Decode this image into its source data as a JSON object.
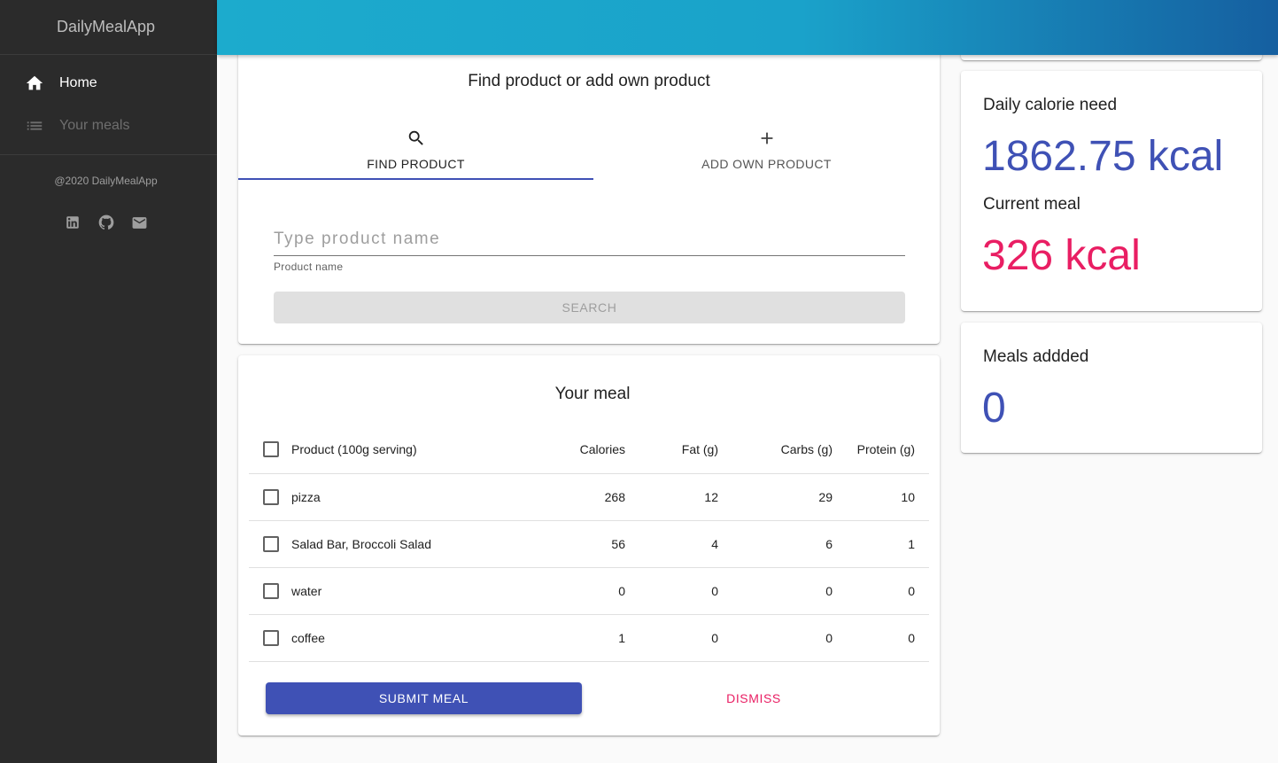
{
  "app": {
    "title": "DailyMealApp"
  },
  "sidebar": {
    "items": [
      {
        "label": "Home",
        "icon": "home-icon",
        "active": true
      },
      {
        "label": "Your meals",
        "icon": "list-icon",
        "active": false
      }
    ],
    "copyright": "@2020 DailyMealApp",
    "socials": [
      "linkedin-icon",
      "github-icon",
      "mail-icon"
    ]
  },
  "find_product": {
    "title": "Find product or add own product",
    "tabs": [
      {
        "label": "FIND PRODUCT",
        "icon": "search-icon",
        "active": true
      },
      {
        "label": "ADD OWN PRODUCT",
        "icon": "plus-icon",
        "active": false
      }
    ],
    "input_placeholder": "Type product name",
    "input_value": "",
    "helper_text": "Product name",
    "search_label": "SEARCH"
  },
  "meal": {
    "title": "Your meal",
    "columns": [
      "Product (100g serving)",
      "Calories",
      "Fat (g)",
      "Carbs (g)",
      "Protein (g)"
    ],
    "rows": [
      {
        "name": "pizza",
        "calories": "268",
        "fat": "12",
        "carbs": "29",
        "protein": "10"
      },
      {
        "name": "Salad Bar, Broccoli Salad",
        "calories": "56",
        "fat": "4",
        "carbs": "6",
        "protein": "1"
      },
      {
        "name": "water",
        "calories": "0",
        "fat": "0",
        "carbs": "0",
        "protein": "0"
      },
      {
        "name": "coffee",
        "calories": "1",
        "fat": "0",
        "carbs": "0",
        "protein": "0"
      }
    ],
    "submit_label": "SUBMIT MEAL",
    "dismiss_label": "DISMISS"
  },
  "stats": {
    "daily_label": "Daily calorie need",
    "daily_value": "1862.75 kcal",
    "current_label": "Current meal",
    "current_value": "326 kcal",
    "meals_label": "Meals addded",
    "meals_value": "0"
  },
  "colors": {
    "primary": "#3f51b5",
    "secondary": "#e91e63",
    "sidebar_bg": "#2b2b2b",
    "topbar_start": "#1cabcd",
    "topbar_end": "#155fa0"
  }
}
